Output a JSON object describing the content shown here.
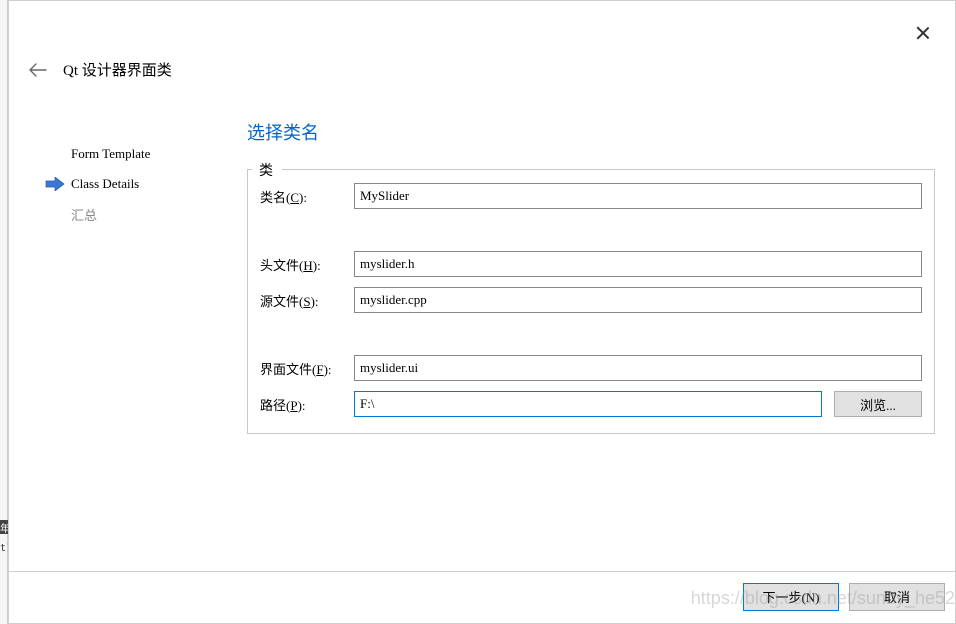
{
  "dialog": {
    "title": "Qt 设计器界面类"
  },
  "sidebar": {
    "steps": [
      {
        "label": "Form Template",
        "active": false,
        "disabled": false
      },
      {
        "label": "Class Details",
        "active": true,
        "disabled": false
      },
      {
        "label": "汇总",
        "active": false,
        "disabled": true
      }
    ]
  },
  "content": {
    "section_title": "选择类名",
    "group_title": "类",
    "fields": {
      "class_name": {
        "label_prefix": "类名(",
        "label_hotkey": "C",
        "label_suffix": "):",
        "value": "MySlider"
      },
      "header_file": {
        "label_prefix": "头文件(",
        "label_hotkey": "H",
        "label_suffix": "):",
        "value": "myslider.h"
      },
      "source_file": {
        "label_prefix": "源文件(",
        "label_hotkey": "S",
        "label_suffix": "):",
        "value": "myslider.cpp"
      },
      "ui_file": {
        "label_prefix": "界面文件(",
        "label_hotkey": "F",
        "label_suffix": "):",
        "value": "myslider.ui"
      },
      "path": {
        "label_prefix": "路径(",
        "label_hotkey": "P",
        "label_suffix": ":",
        "value": "F:\\"
      }
    },
    "browse_label": "浏览..."
  },
  "footer": {
    "next_label": "下一步(N)",
    "cancel_label": "取消"
  },
  "watermark": "https://blog.csdn.net/sunny_he52"
}
